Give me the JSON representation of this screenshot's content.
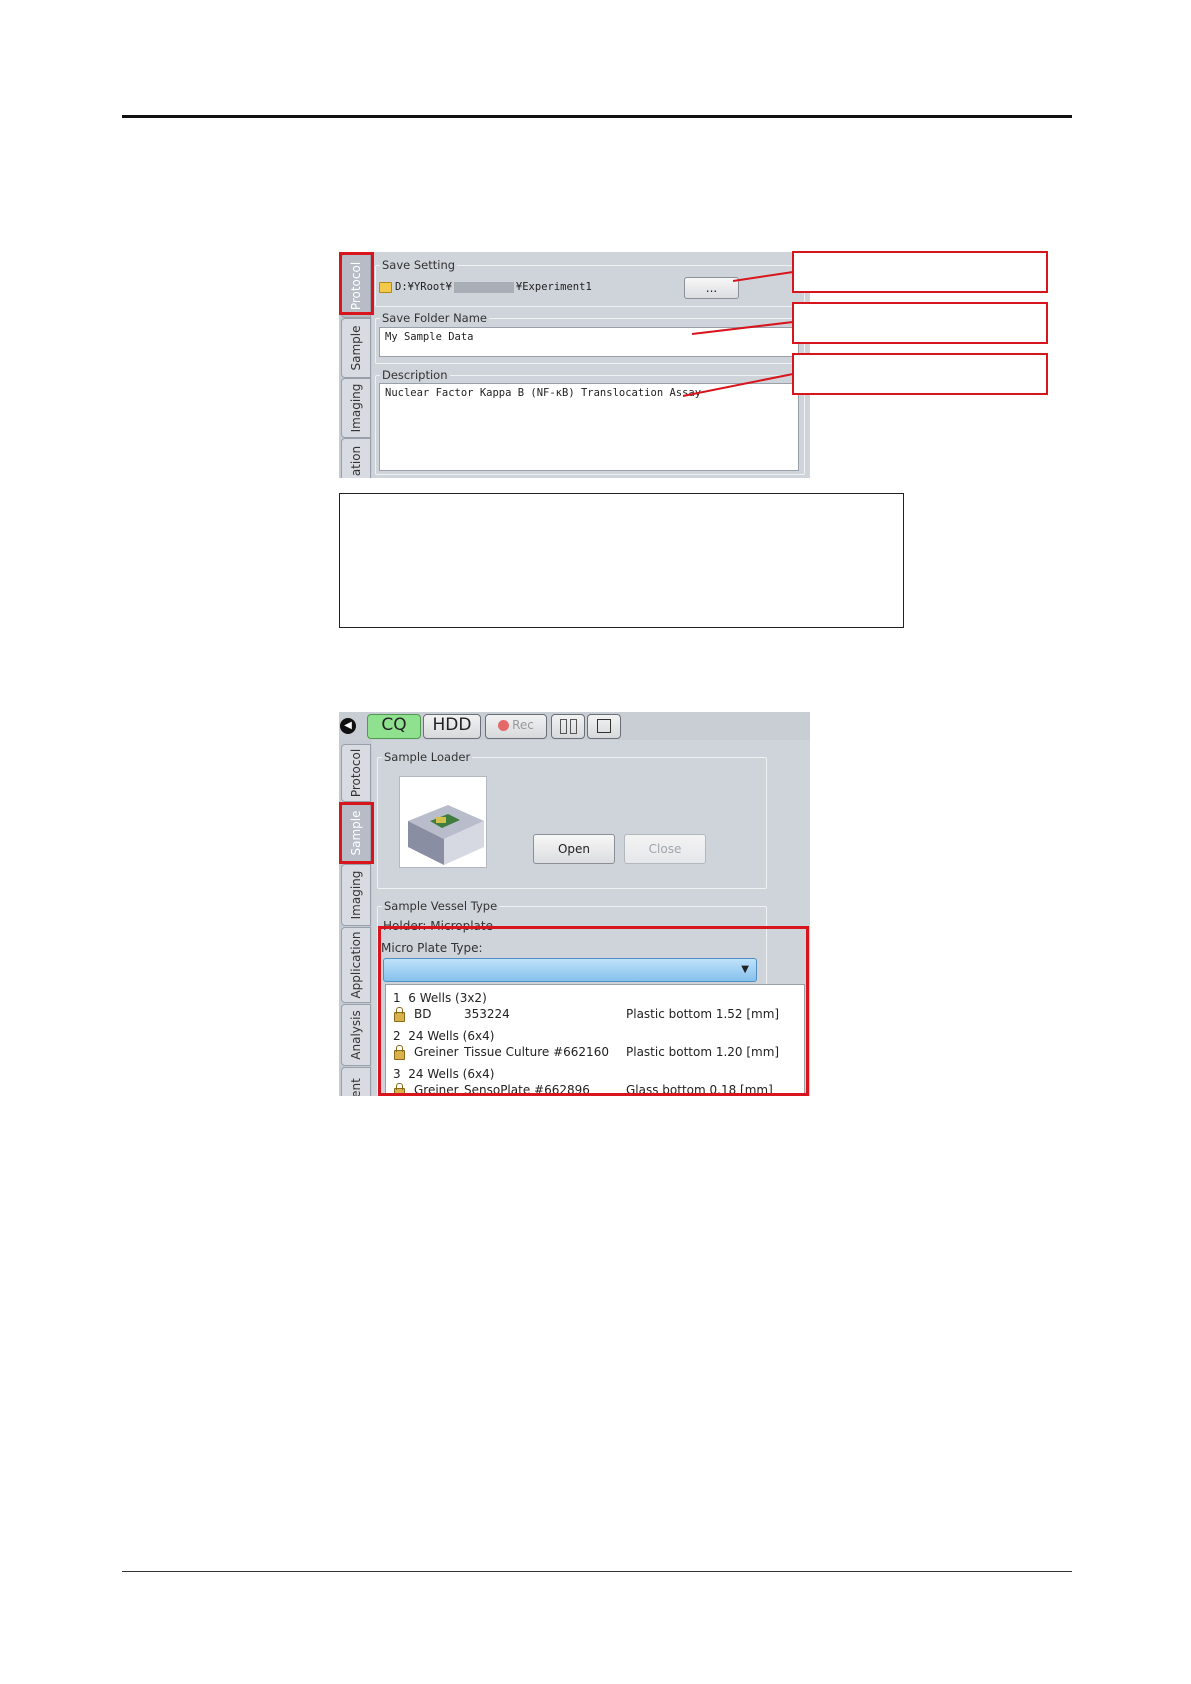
{
  "protocol_screen": {
    "tabs": [
      "Protocol",
      "Sample",
      "Imaging",
      "ation"
    ],
    "save_setting": {
      "title": "Save Setting",
      "path_prefix": "D:¥YRoot¥",
      "path_suffix": "¥Experiment1",
      "browse_label": "..."
    },
    "save_folder": {
      "title": "Save Folder Name",
      "value": "My Sample Data"
    },
    "description": {
      "title": "Description",
      "value": "Nuclear Factor Kappa B (NF-κB) Translocation Assay"
    }
  },
  "sample_screen": {
    "toolbar": {
      "cq": "CQ",
      "hdd": "HDD",
      "rec": "Rec"
    },
    "tabs": [
      "Protocol",
      "Sample",
      "Imaging",
      "Application",
      "Analysis",
      "ent"
    ],
    "sample_loader": {
      "title": "Sample Loader",
      "open": "Open",
      "close": "Close"
    },
    "vessel": {
      "title": "Sample Vessel Type",
      "holder": "Holder: Microplate",
      "plate_type_label": "Micro Plate Type:"
    },
    "plates": [
      {
        "index": "1",
        "wells": "6 Wells (3x2)",
        "maker": "BD",
        "product": "353224",
        "bottom": "Plastic bottom 1.52 [mm]"
      },
      {
        "index": "2",
        "wells": "24 Wells (6x4)",
        "maker": "Greiner",
        "product": "Tissue Culture  #662160",
        "bottom": "Plastic bottom 1.20 [mm]"
      },
      {
        "index": "3",
        "wells": "24 Wells (6x4)",
        "maker": "Greiner",
        "product": "SensoPlate #662896",
        "bottom": "Glass bottom 0.18 [mm]"
      }
    ]
  },
  "colors": {
    "highlight": "#d8141c",
    "panel": "#cfd3da",
    "cq_green": "#8fe08f",
    "dropdown_blue": "#8fc7ee"
  }
}
